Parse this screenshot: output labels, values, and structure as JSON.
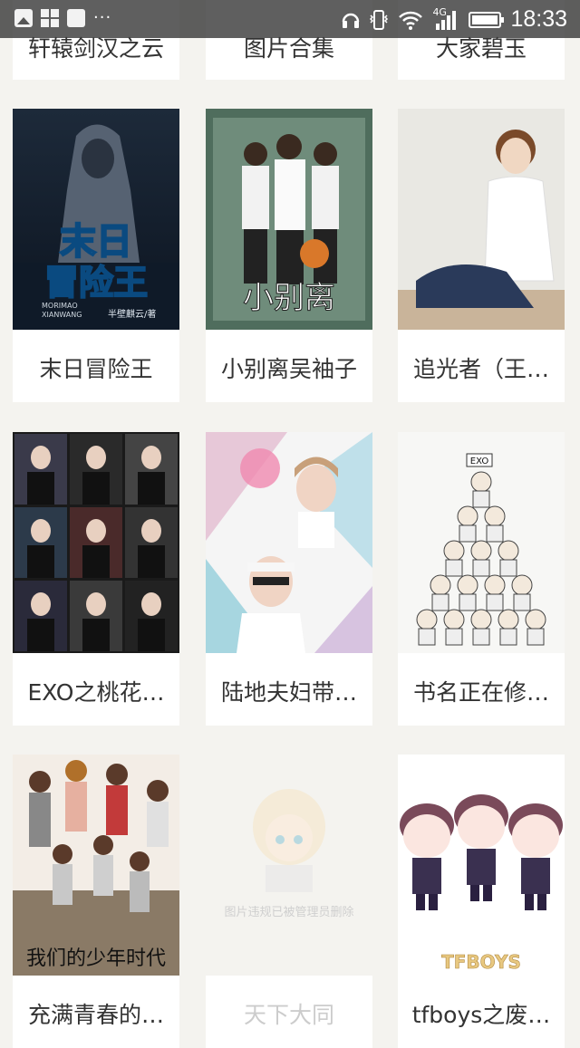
{
  "status_bar": {
    "network_type": "4G",
    "time": "18:33",
    "more_indicator": "···",
    "icons": [
      "image-icon",
      "tiles-icon",
      "notification-icon",
      "headphones-icon",
      "vibrate-icon",
      "wifi-icon",
      "signal-icon",
      "battery-icon"
    ]
  },
  "books": [
    {
      "title": "轩辕剑汉之云",
      "cover": "partial"
    },
    {
      "title": "图片合集",
      "cover": "partial"
    },
    {
      "title": "大家碧玉",
      "cover": "partial"
    },
    {
      "title": "末日冒险王",
      "cover": "dark-hooded-figure",
      "cover_text": "末日冒险王",
      "cover_subtext": "MORIMAO XIANWANG",
      "publisher": "半壁麒云/著"
    },
    {
      "title": "小别离吴袖子",
      "cover": "group-photo",
      "cover_text": "小别离"
    },
    {
      "title": "追光者（王…",
      "cover": "seated-person"
    },
    {
      "title": "EXO之桃花…",
      "cover": "photo-collage"
    },
    {
      "title": "陆地夫妇带…",
      "cover": "couple-photo"
    },
    {
      "title": "书名正在修…",
      "cover": "cartoon-pyramid",
      "cover_text": "EXO"
    },
    {
      "title": "充满青春的…",
      "cover": "group-stairs",
      "cover_text": "我们的少年时代"
    },
    {
      "title": "天下大同",
      "cover": "removed",
      "removed_text": "图片违规已被管理员删除"
    },
    {
      "title": "tfboys之废…",
      "cover": "chibi-trio",
      "cover_text": "TFBOYS"
    }
  ],
  "colors": {
    "background": "#f4f3ef",
    "card": "#ffffff",
    "title": "#333333",
    "status_bar": "#3c3c3c"
  }
}
